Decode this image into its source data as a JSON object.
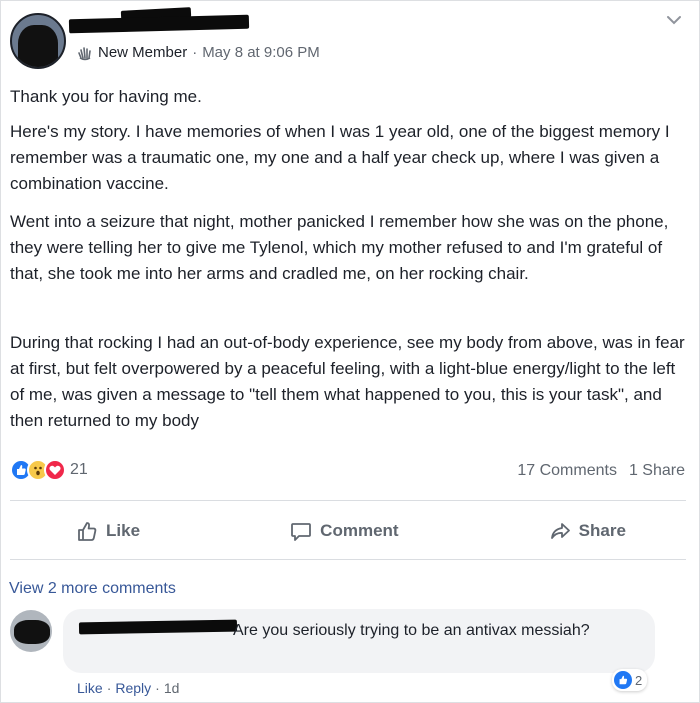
{
  "post": {
    "member_badge": "New Member",
    "timestamp": "May 8 at 9:06 PM",
    "paragraphs": [
      "Thank you for having me.",
      "Here's my story. I have memories of when I was 1 year old, one of the biggest memory I remember was a traumatic one, my one and a half year check up, where I was given a combination vaccine.",
      "Went into a seizure that night, mother panicked I remember how she was on the phone, they were telling her to give me Tylenol, which my mother refused to and I'm grateful of that, she took me into her arms and cradled me, on her rocking chair.",
      "During that rocking I had an out-of-body experience, see my body from above, was in fear at first, but felt overpowered by a peaceful feeling, with a light-blue energy/light to the left of me, was given a message to \"tell them what happened to you, this is your task\", and then returned to my body"
    ],
    "reaction_count": "21",
    "comments_count": "17 Comments",
    "shares_count": "1 Share",
    "reaction_icons": [
      "like-icon",
      "wow-icon",
      "love-icon"
    ]
  },
  "actions": {
    "like": "Like",
    "comment": "Comment",
    "share": "Share"
  },
  "comments": {
    "view_more": "View 2 more comments",
    "first": {
      "text": "Are you seriously trying to be an antivax messiah?",
      "like_label": "Like",
      "reply_label": "Reply",
      "age": "1d",
      "reaction_count": "2"
    }
  },
  "colors": {
    "accent": "#385898",
    "like_blue": "#2078f4",
    "love_red": "#f0284a",
    "wow_yellow": "#f7c94b",
    "muted_text": "#606770"
  }
}
